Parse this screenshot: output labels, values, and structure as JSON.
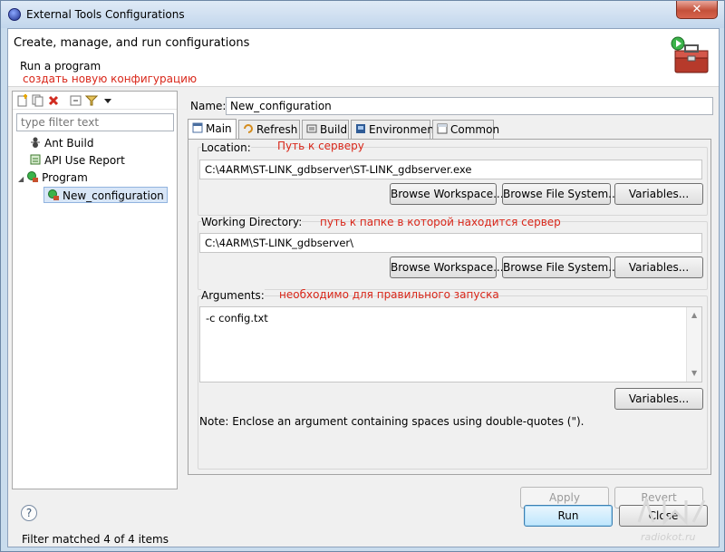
{
  "window": {
    "title": "External Tools Configurations",
    "close_glyph": "✕"
  },
  "header": {
    "title": "Create, manage, and run configurations",
    "subtitle": "Run a program",
    "annotation_new": "создать новую конфигурацию"
  },
  "left": {
    "toolbar_icons": [
      "new-config-icon",
      "duplicate-icon",
      "delete-icon",
      "collapse-all-icon",
      "filter-icon",
      "view-menu-icon"
    ],
    "filter_placeholder": "type filter text",
    "tree": [
      {
        "label": "Ant Build",
        "icon": "ant-icon"
      },
      {
        "label": "API Use Report",
        "icon": "api-report-icon"
      },
      {
        "label": "Program",
        "icon": "program-icon",
        "expanded": true
      },
      {
        "label": "New_configuration",
        "icon": "program-config-icon",
        "selected": true
      }
    ],
    "status": "Filter matched 4 of 4 items",
    "expand_glyph": "◢"
  },
  "main": {
    "name_label": "Name:",
    "name_value": "New_configuration",
    "tabs": [
      {
        "label": "Main",
        "icon": "main-tab-icon",
        "active": true
      },
      {
        "label": "Refresh",
        "icon": "refresh-icon"
      },
      {
        "label": "Build",
        "icon": "build-icon"
      },
      {
        "label": "Environment",
        "icon": "environment-icon"
      },
      {
        "label": "Common",
        "icon": "common-icon"
      }
    ],
    "location": {
      "label": "Location:",
      "annotation": "Путь к серверу",
      "value": "C:\\4ARM\\ST-LINK_gdbserver\\ST-LINK_gdbserver.exe",
      "buttons": [
        "Browse Workspace...",
        "Browse File System...",
        "Variables..."
      ]
    },
    "working_dir": {
      "label": "Working Directory:",
      "annotation": "путь к папке в которой находится сервер",
      "value": "C:\\4ARM\\ST-LINK_gdbserver\\",
      "buttons": [
        "Browse Workspace...",
        "Browse File System...",
        "Variables..."
      ]
    },
    "arguments": {
      "label": "Arguments:",
      "annotation": "необходимо для правильного запуска",
      "value": "-c config.txt",
      "variables_button": "Variables...",
      "note": "Note: Enclose an argument containing spaces using double-quotes (\")."
    },
    "scroll_up": "▲",
    "scroll_down": "▼",
    "apply_button": "Apply",
    "revert_button": "Revert"
  },
  "footer": {
    "help_glyph": "?",
    "run_button": "Run",
    "close_button": "Close"
  },
  "watermark": "radiokot.ru",
  "colors": {
    "annotation": "#d9271a",
    "selection": "#d8e6f7"
  }
}
